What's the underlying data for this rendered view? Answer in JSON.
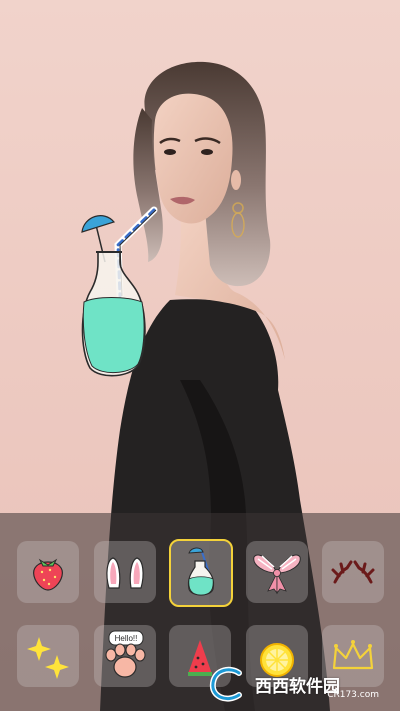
{
  "photo": {
    "description_icon": "portrait-photo",
    "background_color": "#f2d4cb"
  },
  "applied_sticker": {
    "icon": "drink-bottle-with-straw-and-umbrella",
    "liquid_color": "#6fe3c6"
  },
  "sticker_panel": {
    "selected_index": 2,
    "selected_border_color": "#f4d23a",
    "stickers": [
      {
        "icon": "strawberry-icon"
      },
      {
        "icon": "bunny-ears-icon"
      },
      {
        "icon": "drink-bottle-icon"
      },
      {
        "icon": "pink-bow-icon"
      },
      {
        "icon": "antlers-icon"
      },
      {
        "icon": "sparkles-icon"
      },
      {
        "icon": "paw-hello-icon",
        "text": "Hello!!"
      },
      {
        "icon": "watermelon-icon"
      },
      {
        "icon": "lemon-icon"
      },
      {
        "icon": "crown-icon"
      }
    ]
  },
  "watermark": {
    "text": "西西软件园",
    "sub": "CR173.com"
  }
}
